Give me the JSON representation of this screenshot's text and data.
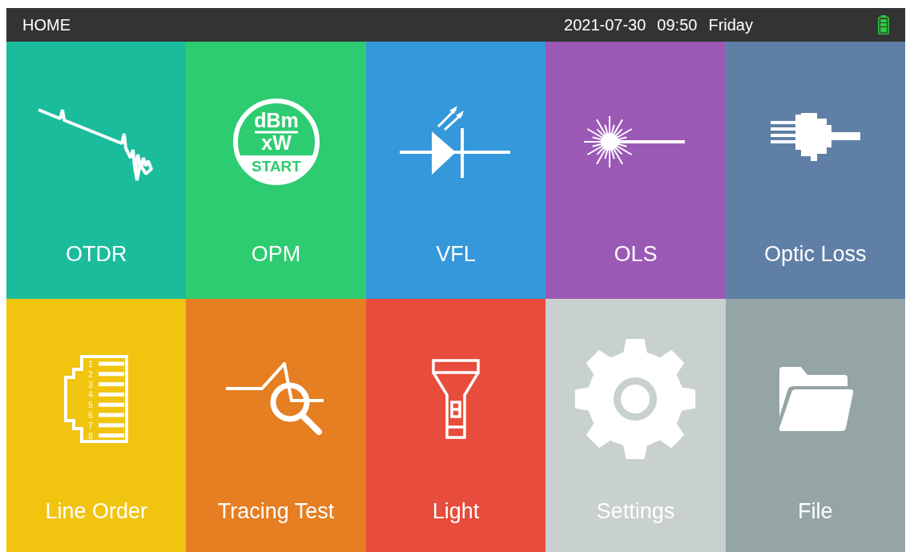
{
  "status_bar": {
    "title": "HOME",
    "date": "2021-07-30",
    "time": "09:50",
    "weekday": "Friday"
  },
  "tiles": [
    {
      "label": "OTDR",
      "kind": "otdr",
      "color": "#1abc9c"
    },
    {
      "label": "OPM",
      "kind": "opm",
      "color": "#2ecc71",
      "icon_texts": [
        "dBm",
        "xW",
        "START"
      ]
    },
    {
      "label": "VFL",
      "kind": "vfl",
      "color": "#3498db"
    },
    {
      "label": "OLS",
      "kind": "ols",
      "color": "#9b59b6"
    },
    {
      "label": "Optic Loss",
      "kind": "loss",
      "color": "#5f7fa6"
    },
    {
      "label": "Line Order",
      "kind": "lineorder",
      "color": "#f1c40f",
      "icon_texts": [
        "1",
        "2",
        "3",
        "4",
        "5",
        "6",
        "7",
        "8"
      ]
    },
    {
      "label": "Tracing Test",
      "kind": "tracing",
      "color": "#e67e22"
    },
    {
      "label": "Light",
      "kind": "light",
      "color": "#e74c3c"
    },
    {
      "label": "Settings",
      "kind": "settings",
      "color": "#c8d1d0"
    },
    {
      "label": "File",
      "kind": "file",
      "color": "#95a5a6"
    }
  ]
}
